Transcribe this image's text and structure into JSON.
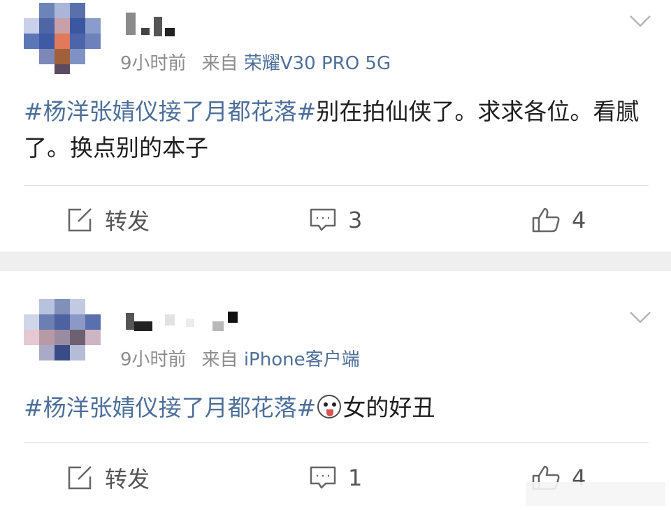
{
  "posts": [
    {
      "time": "9小时前",
      "source_prefix": "来自",
      "device": "荣耀V30 PRO 5G",
      "topic": "#杨洋张婧仪接了月都花落#",
      "text": "别在拍仙侠了。求求各位。看腻了。换点别的本子",
      "actions": {
        "repost": "转发",
        "comments": "3",
        "likes": "4"
      }
    },
    {
      "time": "9小时前",
      "source_prefix": "来自",
      "device": "iPhone客户端",
      "topic": "#杨洋张婧仪接了月都花落#",
      "text": "女的好丑",
      "actions": {
        "repost": "转发",
        "comments": "1",
        "likes": "4"
      }
    }
  ],
  "icons": {
    "repost": "edit-square-icon",
    "comment": "comment-bubble-icon",
    "like": "thumbs-up-icon",
    "more": "chevron-down-icon",
    "emoji": "dog-face-emoji-icon"
  },
  "colors": {
    "topic": "#4d6f9a",
    "text": "#1e1e1e",
    "meta": "#8c8c8c",
    "separator": "#efefef"
  }
}
